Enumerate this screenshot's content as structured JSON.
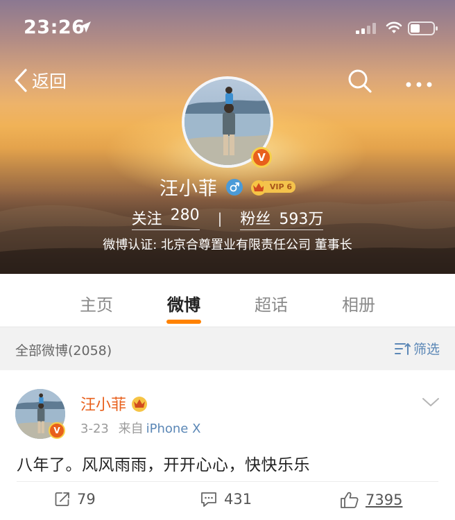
{
  "status_bar": {
    "time": "23:26"
  },
  "nav": {
    "back_label": "返回"
  },
  "profile": {
    "name": "汪小菲",
    "vip_label": "VIP 6",
    "following_label": "关注",
    "following_count": "280",
    "separator": "|",
    "followers_label": "粉丝",
    "followers_count": "593万",
    "verification": "微博认证: 北京合尊置业有限责任公司 董事长",
    "verified_mark": "V"
  },
  "tabs": [
    {
      "label": "主页",
      "active": false
    },
    {
      "label": "微博",
      "active": true
    },
    {
      "label": "超话",
      "active": false
    },
    {
      "label": "相册",
      "active": false
    }
  ],
  "filter_bar": {
    "title": "全部微博(2058)",
    "filter_label": "筛选"
  },
  "post": {
    "author": "汪小菲",
    "date": "3-23",
    "source_prefix": "来自",
    "source": "iPhone X",
    "text": "八年了。风风雨雨，开开心心，快快乐乐",
    "repost_count": "79",
    "comment_count": "431",
    "like_count": "7395",
    "verified_mark": "V"
  },
  "colors": {
    "accent_orange": "#ff8200",
    "author_orange": "#e8601c",
    "link_blue": "#5b87b6"
  },
  "icons": [
    "location-arrow-icon",
    "signal-icon",
    "wifi-icon",
    "battery-icon",
    "back-chevron-icon",
    "search-icon",
    "more-icon",
    "male-icon",
    "vip-crown-icon",
    "filter-icon",
    "chevron-down-icon",
    "repost-icon",
    "comment-icon",
    "like-icon"
  ]
}
